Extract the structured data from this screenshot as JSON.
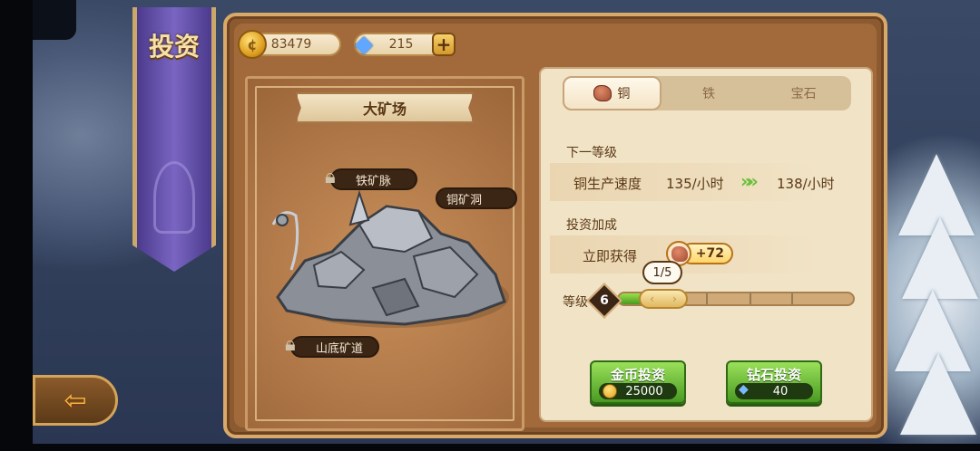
{
  "banner": {
    "title": "投资"
  },
  "currency": {
    "gold": "83479",
    "gems": "215"
  },
  "mine": {
    "title": "大矿场",
    "locations": {
      "iron_vein": "铁矿脉",
      "copper_cave": "铜矿洞",
      "mountain_tunnel": "山底矿道"
    }
  },
  "tabs": {
    "copper": "铜",
    "iron": "铁",
    "gem": "宝石"
  },
  "next_level": {
    "label": "下一等级",
    "rate_label": "铜生产速度",
    "current_rate": "135/小时",
    "next_rate": "138/小时"
  },
  "bonus": {
    "label": "投资加成",
    "instant_label": "立即获得",
    "instant_amount": "+72"
  },
  "level": {
    "label": "等级",
    "value": "6",
    "progress_text": "1/5",
    "progress": 0.2
  },
  "buttons": {
    "gold_invest": {
      "label": "金币投资",
      "cost": "25000"
    },
    "gem_invest": {
      "label": "钻石投资",
      "cost": "40"
    }
  },
  "colors": {
    "accent_green": "#6ac03a",
    "panel_brown": "#8c5a30",
    "banner_purple": "#6a56b4"
  }
}
